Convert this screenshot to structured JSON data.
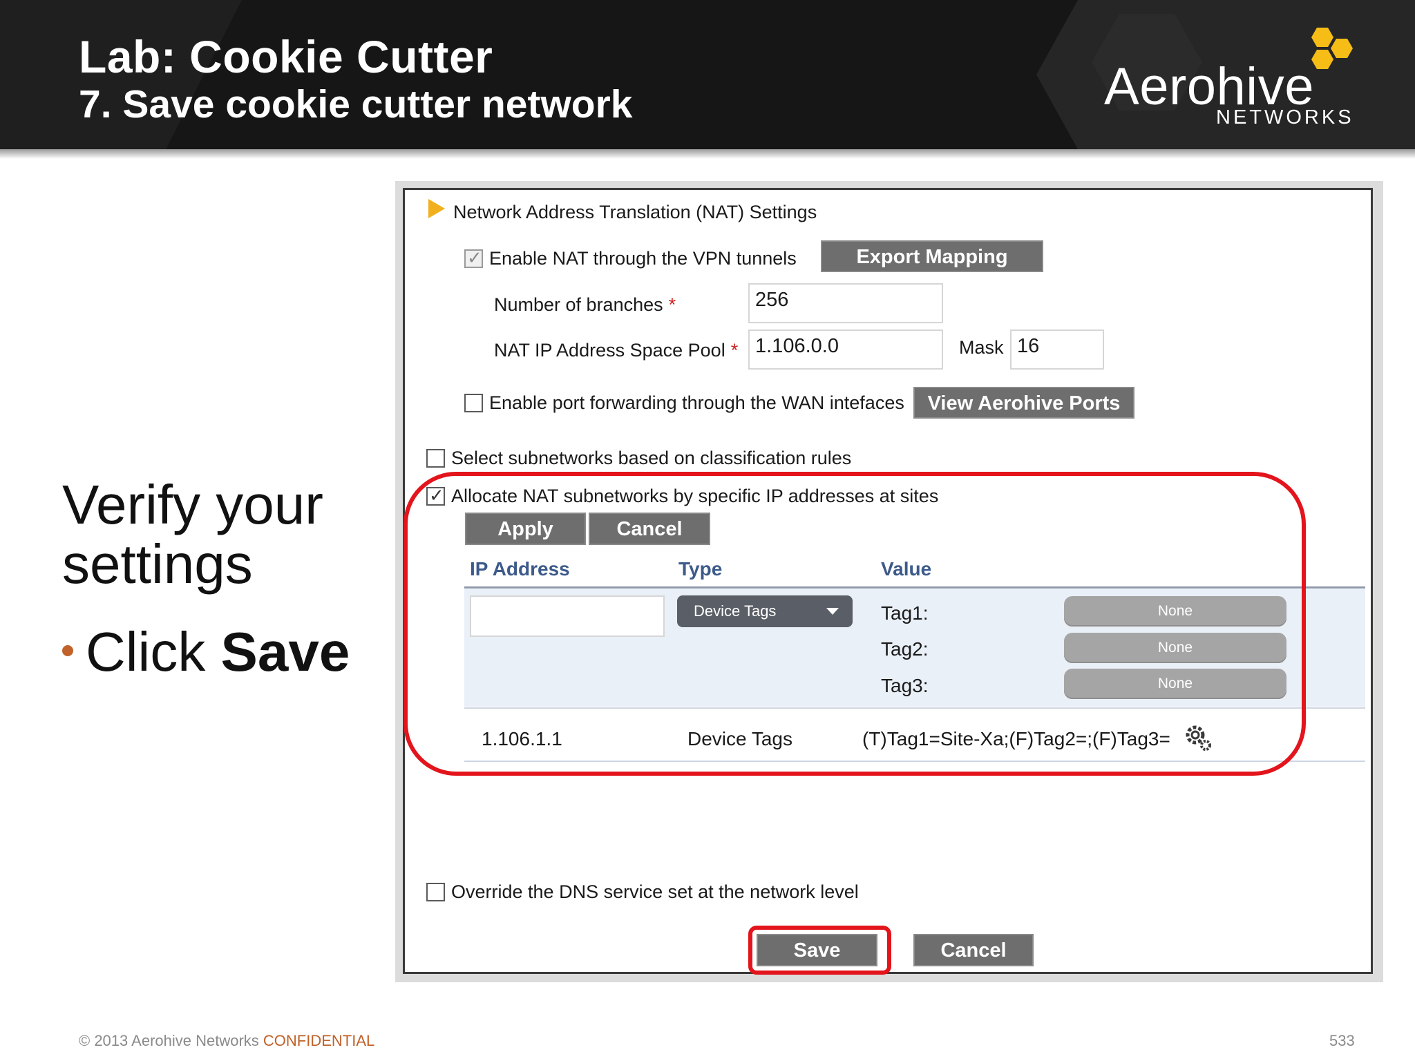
{
  "slide": {
    "title": "Lab: Cookie Cutter",
    "subtitle": "7. Save cookie cutter network",
    "logo_word": "Aerohive",
    "logo_sub": "NETWORKS",
    "instruction": "Verify your settings",
    "bullet_prefix": "Click ",
    "bullet_bold": "Save",
    "copyright": "© 2013 Aerohive Networks",
    "confidential": "CONFIDENTIAL",
    "page_number": "533",
    "accent_color": "#c0622a",
    "highlight_color": "#e3141b"
  },
  "nat": {
    "section_title": "Network Address Translation (NAT) Settings",
    "enable_nat_label": "Enable NAT through the VPN tunnels",
    "enable_nat_checked": true,
    "export_mapping_label": "Export Mapping",
    "branches_label": "Number of branches",
    "branches_value": "256",
    "pool_label": "NAT IP Address Space Pool",
    "pool_value": "1.106.0.0",
    "mask_label": "Mask",
    "mask_value": "16",
    "required_mark": "*",
    "port_forwarding_label": "Enable port forwarding through the WAN intefaces",
    "port_forwarding_checked": false,
    "view_ports_label": "View Aerohive Ports",
    "classification_label": "Select subnetworks based on classification rules",
    "classification_checked": false,
    "allocate_label": "Allocate NAT subnetworks by specific IP addresses at sites",
    "allocate_checked": true
  },
  "table": {
    "apply_label": "Apply",
    "cancel_label": "Cancel",
    "columns": [
      "IP Address",
      "Type",
      "Value"
    ],
    "edit_row": {
      "ip_value": "",
      "type_selected": "Device Tags",
      "tags": [
        {
          "label": "Tag1:",
          "value": "None"
        },
        {
          "label": "Tag2:",
          "value": "None"
        },
        {
          "label": "Tag3:",
          "value": "None"
        }
      ]
    },
    "rows": [
      {
        "ip": "1.106.1.1",
        "type": "Device Tags",
        "value": "(T)Tag1=Site-Xa;(F)Tag2=;(F)Tag3="
      }
    ]
  },
  "dns": {
    "override_label": "Override the DNS service set at the network level",
    "override_checked": false
  },
  "footer_buttons": {
    "save_label": "Save",
    "cancel_label": "Cancel"
  }
}
